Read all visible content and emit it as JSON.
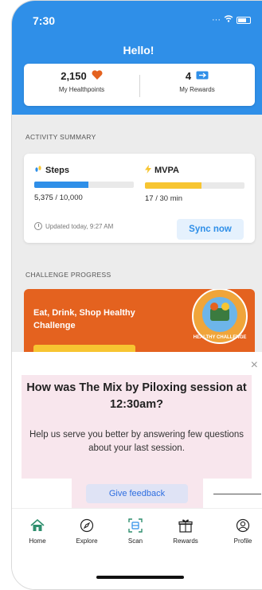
{
  "status_bar": {
    "time": "7:30",
    "signal": "···"
  },
  "header": {
    "greeting": "Hello!"
  },
  "summary": {
    "healthpoints_value": "2,150",
    "healthpoints_label": "My Healthpoints",
    "rewards_value": "4",
    "rewards_label": "My Rewards"
  },
  "activity": {
    "section_title": "ACTIVITY SUMMARY",
    "steps": {
      "title": "Steps",
      "current": "5,375",
      "goal": "/ 10,000",
      "progress": 0.54,
      "color": "#2f8fe8"
    },
    "mvpa": {
      "title": "MVPA",
      "current": "17",
      "goal": "/ 30 min",
      "progress": 0.57,
      "color": "#f7c531"
    },
    "updated": "Updated today, 9:27 AM",
    "sync_label": "Sync now"
  },
  "challenge": {
    "section_title": "CHALLENGE PROGRESS",
    "title": "Eat, Drink, Shop Healthy Challenge",
    "badge_text": "HEALTHY CHALLENGE"
  },
  "feedback_sheet": {
    "question": "How was The Mix by Piloxing session at 12:30am?",
    "description": "Help us serve you better by answering few questions about your last session.",
    "button_label": "Give feedback",
    "close_icon": "×"
  },
  "tabs": [
    {
      "label": "Home",
      "icon": "home-icon"
    },
    {
      "label": "Explore",
      "icon": "compass-icon"
    },
    {
      "label": "Scan",
      "icon": "scan-icon"
    },
    {
      "label": "Rewards",
      "icon": "gift-icon"
    },
    {
      "label": "Profile",
      "icon": "profile-icon"
    }
  ],
  "colors": {
    "accent": "#2f8fe8",
    "challenge": "#e4621f",
    "heart": "#e4621f",
    "home_active": "#2f8f6e"
  }
}
